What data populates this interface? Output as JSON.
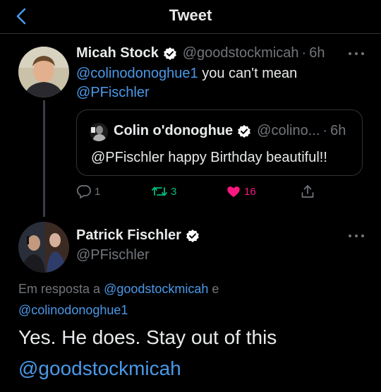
{
  "header": {
    "title": "Tweet"
  },
  "tweet1": {
    "name": "Micah Stock",
    "handle": "@goodstockmicah",
    "separator": "·",
    "time": "6h",
    "text_mention1": "@colinodonoghue1",
    "text_body": " you can't mean",
    "text_mention2": "@PFischler",
    "quote": {
      "name": "Colin o'donoghue",
      "handle": "@colino...",
      "separator": "·",
      "time": "6h",
      "text": "@PFischler happy Birthday beautiful!!"
    },
    "actions": {
      "reply_count": "1",
      "retweet_count": "3",
      "like_count": "16"
    }
  },
  "tweet2": {
    "name": "Patrick Fischler",
    "handle": "@PFischler",
    "reply_prefix": "Em resposta a ",
    "reply_user1": "@goodstockmicah",
    "reply_and": " e",
    "reply_user2": "@colinodonoghue1",
    "text_line1": "Yes. He does. Stay out of this",
    "text_mention": "@goodstockmicah"
  },
  "colors": {
    "link": "#4a99e9",
    "retweet": "#00ba7c",
    "like": "#f91880",
    "muted": "#71767b",
    "verified": "#ffffff"
  },
  "icons": [
    "back-arrow-icon",
    "verified-icon",
    "more-icon",
    "reply-icon",
    "retweet-icon",
    "heart-icon",
    "share-icon"
  ]
}
